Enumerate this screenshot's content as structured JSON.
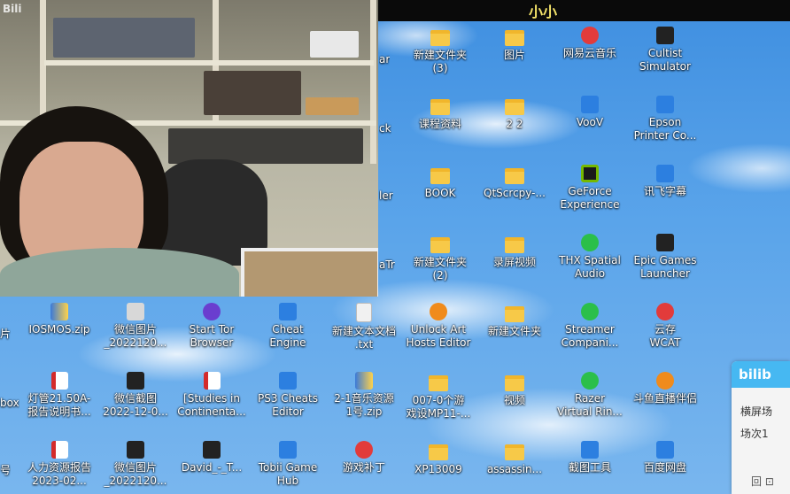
{
  "topbar": {
    "text": "小小"
  },
  "webcam": {
    "logo": "Bili"
  },
  "icons": [
    {
      "label1": "新建文件夹",
      "label2": "(3)",
      "glyph": "folder"
    },
    {
      "label1": "图片",
      "label2": "",
      "glyph": "folder"
    },
    {
      "label1": "网易云音乐",
      "label2": "",
      "glyph": "red"
    },
    {
      "label1": "Cultist",
      "label2": "Simulator",
      "glyph": "dark"
    },
    {
      "label1": "课程资料",
      "label2": "",
      "glyph": "folder"
    },
    {
      "label1": "2 2",
      "label2": "",
      "glyph": "folder"
    },
    {
      "label1": "VooV",
      "label2": "",
      "glyph": "blue"
    },
    {
      "label1": "Epson",
      "label2": "Printer Co...",
      "glyph": "blue"
    },
    {
      "label1": "BOOK",
      "label2": "",
      "glyph": "folder"
    },
    {
      "label1": "QtScrcpy-...",
      "label2": "",
      "glyph": "folder"
    },
    {
      "label1": "GeForce",
      "label2": "Experience",
      "glyph": "nvidia"
    },
    {
      "label1": "讯飞字幕",
      "label2": "",
      "glyph": "blue"
    },
    {
      "label1": "新建文件夹",
      "label2": "(2)",
      "glyph": "folder"
    },
    {
      "label1": "录屏视频",
      "label2": "",
      "glyph": "folder"
    },
    {
      "label1": "THX Spatial",
      "label2": "Audio",
      "glyph": "green"
    },
    {
      "label1": "Epic Games",
      "label2": "Launcher",
      "glyph": "dark"
    },
    {
      "label1": "IOSMOS.zip",
      "label2": "",
      "glyph": "zip"
    },
    {
      "label1": "微信图片",
      "label2": "_2022120...",
      "glyph": "gray"
    },
    {
      "label1": "Start Tor",
      "label2": "Browser",
      "glyph": "purple"
    },
    {
      "label1": "Cheat",
      "label2": "Engine",
      "glyph": "blue"
    },
    {
      "label1": "新建文本文档",
      "label2": ".txt",
      "glyph": "doc"
    },
    {
      "label1": "Unlock Art",
      "label2": "Hosts Editor",
      "glyph": "orange"
    },
    {
      "label1": "新建文件夹",
      "label2": "",
      "glyph": "folder"
    },
    {
      "label1": "Streamer",
      "label2": "Compani...",
      "glyph": "green"
    },
    {
      "label1": "云存",
      "label2": "WCAT",
      "glyph": "red"
    },
    {
      "label1": "灯管21.50A-",
      "label2": "报告说明书...",
      "glyph": "pdf"
    },
    {
      "label1": "微信截图",
      "label2": "2022-12-0...",
      "glyph": "dark"
    },
    {
      "label1": "[Studies in",
      "label2": "Continenta...",
      "glyph": "pdf"
    },
    {
      "label1": "PS3 Cheats",
      "label2": "Editor",
      "glyph": "blue"
    },
    {
      "label1": "2-1音乐资源",
      "label2": "1号.zip",
      "glyph": "zip"
    },
    {
      "label1": "007-0个游",
      "label2": "戏设MP11-...",
      "glyph": "folder"
    },
    {
      "label1": "视频",
      "label2": "",
      "glyph": "folder"
    },
    {
      "label1": "Razer",
      "label2": "Virtual Rin...",
      "glyph": "green"
    },
    {
      "label1": "斗鱼直播伴侣",
      "label2": "",
      "glyph": "orange"
    },
    {
      "label1": "人力资源报告",
      "label2": "2023-02...",
      "glyph": "pdf"
    },
    {
      "label1": "微信图片",
      "label2": "_2022120...",
      "glyph": "dark"
    },
    {
      "label1": "David_-_T...",
      "label2": "",
      "glyph": "dark"
    },
    {
      "label1": "Tobii Game",
      "label2": "Hub",
      "glyph": "blue"
    },
    {
      "label1": "游戏补丁",
      "label2": "",
      "glyph": "red"
    },
    {
      "label1": "XP13009",
      "label2": "",
      "glyph": "folder"
    },
    {
      "label1": "assassin...",
      "label2": "",
      "glyph": "folder"
    },
    {
      "label1": "截图工具",
      "label2": "",
      "glyph": "blue"
    },
    {
      "label1": "百度网盘",
      "label2": "",
      "glyph": "blue"
    }
  ],
  "edge_labels": [
    {
      "text": "ar"
    },
    {
      "text": "ck"
    },
    {
      "text": "ler"
    },
    {
      "text": "aTr"
    },
    {
      "text": "片"
    },
    {
      "text": "box"
    },
    {
      "text": "号"
    }
  ],
  "chat": {
    "logo": "bilib",
    "line1": "横屏场",
    "line2": "场次1",
    "footer": "回  ⊡"
  }
}
